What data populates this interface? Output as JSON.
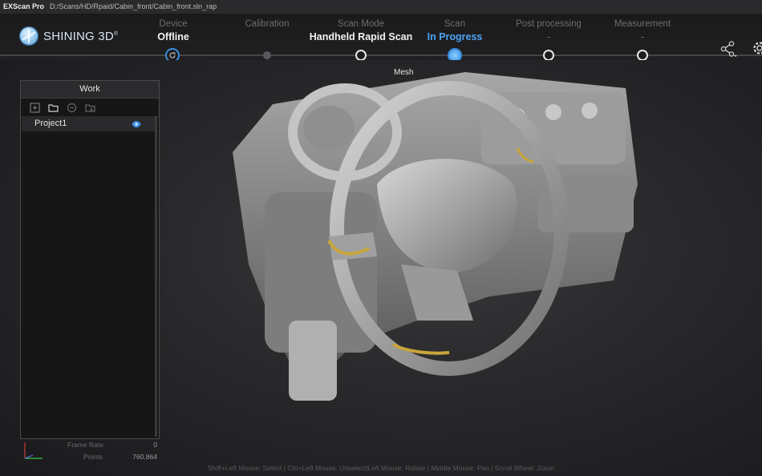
{
  "window": {
    "app_name": "EXScan Pro",
    "file_path": "D:/Scans/HD/Rpaid/Cabin_front/Cabin_front.sln_rap"
  },
  "brand": {
    "name": "SHINING 3D",
    "mark": "®"
  },
  "steps": [
    {
      "label": "Device",
      "value": "Offline",
      "state": "device"
    },
    {
      "label": "Calibration",
      "value": "",
      "state": "inactive"
    },
    {
      "label": "Scan Mode",
      "value": "Handheld Rapid Scan",
      "state": "done"
    },
    {
      "label": "Scan",
      "value": "In Progress",
      "state": "active"
    },
    {
      "label": "Post processing",
      "value": "-",
      "state": "pending"
    },
    {
      "label": "Measurement",
      "value": "-",
      "state": "pending"
    }
  ],
  "viewport": {
    "mesh_label": "Mesh"
  },
  "panel": {
    "title": "Work",
    "tools": [
      "add-icon",
      "folder-open-icon",
      "remove-icon",
      "export-icon"
    ],
    "items": [
      {
        "name": "Project1",
        "visible": true
      }
    ]
  },
  "stats": {
    "frame_rate_label": "Frame Rate",
    "frame_rate_value": "0",
    "points_label": "Points",
    "points_value": "760,864"
  },
  "hint": "Shift+Left Mouse: Select | Ctrl+Left Mouse: Unselect|Left Mouse: Rotate | Middle Mouse: Pan | Scroll Wheel: Zoom",
  "colors": {
    "accent": "#3a92e6",
    "active_text": "#4aa3f5",
    "scan_highlight": "#c9a63a"
  }
}
